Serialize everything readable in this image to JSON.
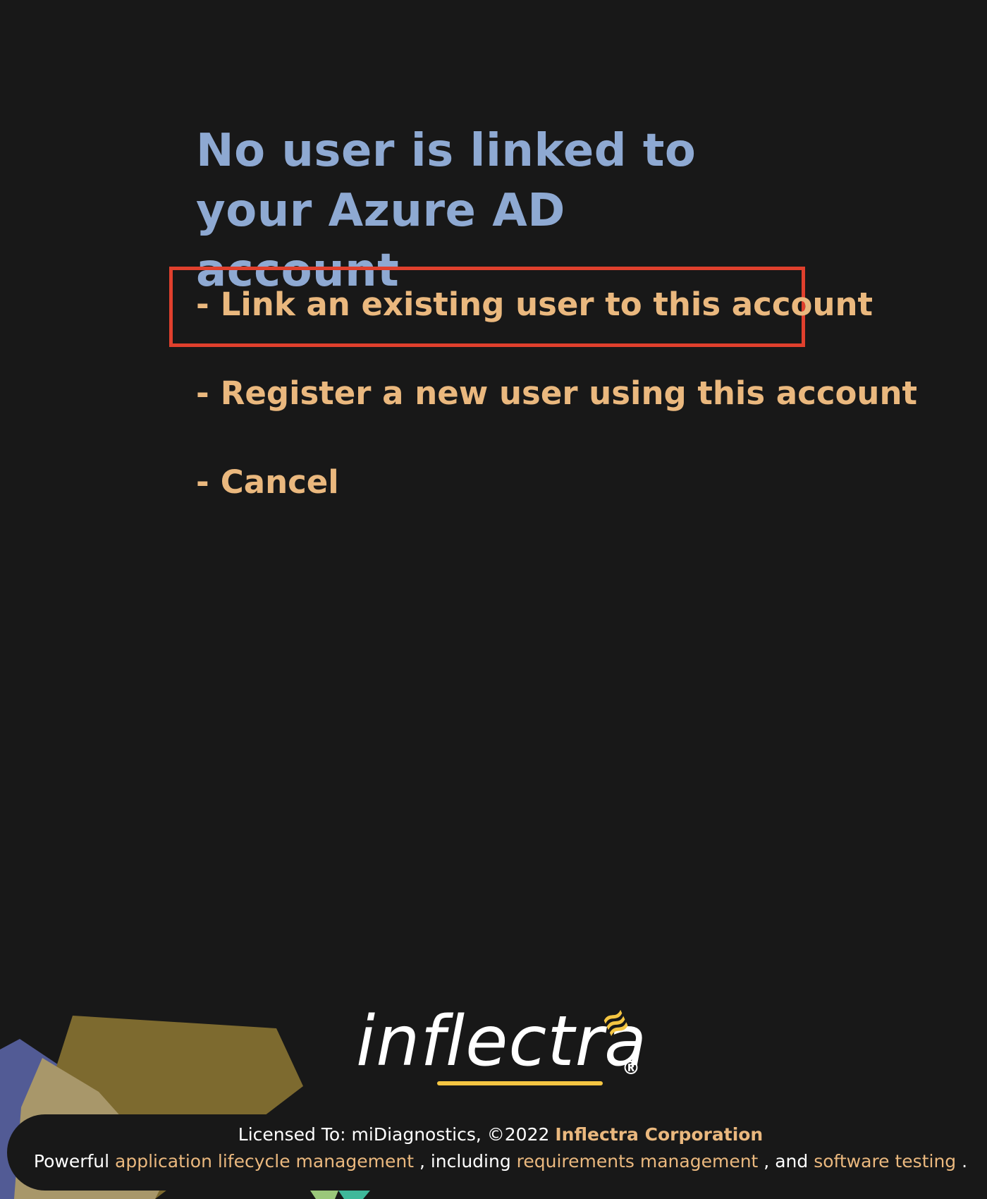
{
  "page": {
    "title": "No user is linked to your Azure AD account"
  },
  "options": [
    {
      "dash": "-",
      "label": "Link an existing user to this account"
    },
    {
      "dash": "-",
      "label": "Register a new user using this account"
    },
    {
      "dash": "-",
      "label": "Cancel"
    }
  ],
  "logo": {
    "text": "inflectra",
    "registered": "®",
    "waves": "≋"
  },
  "footer": {
    "licensed_prefix": "Licensed To: miDiagnostics, ©2022 ",
    "company": "Inflectra Corporation",
    "powerful": "Powerful ",
    "link_alm": "application lifecycle management",
    "including": " , including ",
    "link_req": "requirements management",
    "and": " , and ",
    "link_testing": "software testing",
    "period": " ."
  },
  "colors": {
    "background": "#181818",
    "title": "#8ea9d2",
    "option": "#eab87e",
    "highlight": "#e0402d",
    "logo_accent": "#f4c542"
  }
}
